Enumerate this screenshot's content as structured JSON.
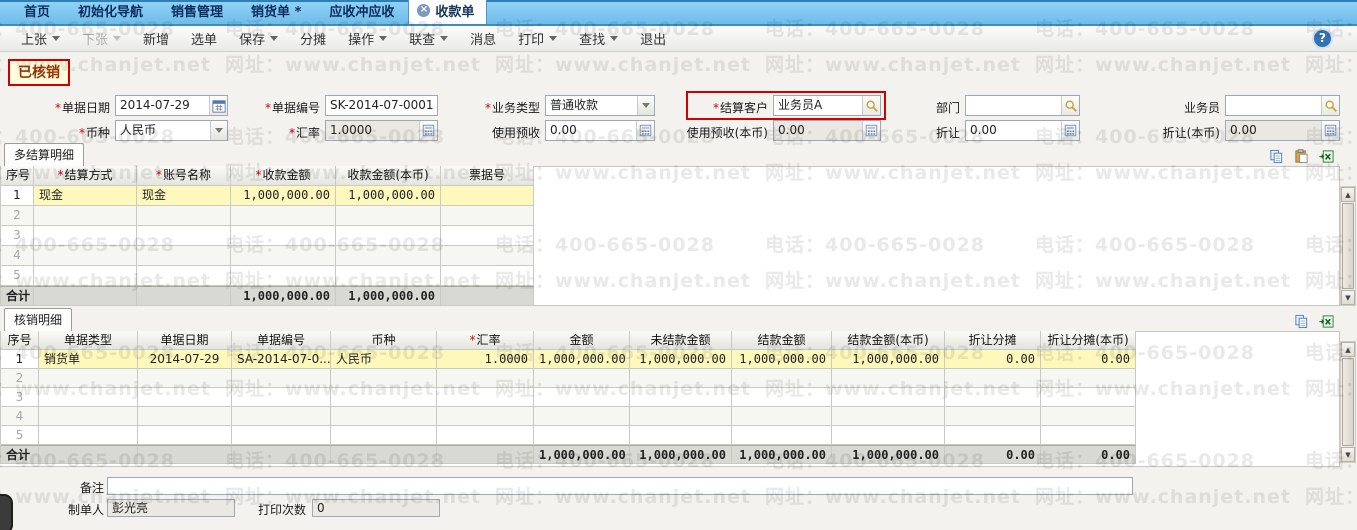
{
  "watermark": {
    "phone": "电话：400-665-0028",
    "url": "网址：www.chanjet.net"
  },
  "tabbar": {
    "tabs": [
      {
        "label": "首页"
      },
      {
        "label": "初始化导航"
      },
      {
        "label": "销售管理"
      },
      {
        "label": "销货单 *"
      },
      {
        "label": "应收冲应收"
      }
    ],
    "active_tab": {
      "label": "收款单"
    }
  },
  "toolbar": {
    "items": [
      {
        "label": "上张"
      },
      {
        "label": "下张"
      },
      {
        "label": "新增"
      },
      {
        "label": "选单"
      },
      {
        "label": "保存"
      },
      {
        "label": "分摊"
      },
      {
        "label": "操作"
      },
      {
        "label": "联查"
      },
      {
        "label": "消息"
      },
      {
        "label": "打印"
      },
      {
        "label": "查找"
      },
      {
        "label": "退出"
      }
    ],
    "help": "?"
  },
  "status_badge": "已核销",
  "form": {
    "bill_date": {
      "label": "单据日期",
      "value": "2014-07-29"
    },
    "bill_no": {
      "label": "单据编号",
      "value": "SK-2014-07-0001"
    },
    "biz_type": {
      "label": "业务类型",
      "value": "普通收款"
    },
    "customer": {
      "label": "结算客户",
      "value": "业务员A"
    },
    "dept": {
      "label": "部门",
      "value": ""
    },
    "salesman": {
      "label": "业务员",
      "value": ""
    },
    "currency": {
      "label": "币种",
      "value": "人民币"
    },
    "rate": {
      "label": "汇率",
      "value": "1.0000"
    },
    "advance": {
      "label": "使用预收",
      "value": "0.00"
    },
    "advance_local": {
      "label": "使用预收(本币)",
      "value": "0.00"
    },
    "discount": {
      "label": "折让",
      "value": "0.00"
    },
    "discount_local": {
      "label": "折让(本币)",
      "value": "0.00"
    }
  },
  "section1": {
    "tab_label": "多结算明细",
    "table": {
      "widths": [
        33,
        103,
        94,
        105,
        105,
        93
      ],
      "aligns": [
        "center",
        "left",
        "left",
        "right",
        "right",
        "left"
      ],
      "headers": [
        {
          "label": "序号"
        },
        {
          "label": "结算方式",
          "req": true
        },
        {
          "label": "账号名称",
          "req": true
        },
        {
          "label": "收款金额",
          "req": true
        },
        {
          "label": "收款金额(本币)"
        },
        {
          "label": "票据号"
        }
      ],
      "rows": [
        {
          "highlight": true,
          "cells": [
            "1",
            "现金",
            "现金",
            "1,000,000.00",
            "1,000,000.00",
            ""
          ]
        },
        {
          "cells": [
            "2",
            "",
            "",
            "",
            "",
            ""
          ]
        },
        {
          "cells": [
            "3",
            "",
            "",
            "",
            "",
            ""
          ]
        },
        {
          "cells": [
            "4",
            "",
            "",
            "",
            "",
            ""
          ]
        },
        {
          "cells": [
            "5",
            "",
            "",
            "",
            "",
            ""
          ]
        }
      ],
      "total": [
        "合计",
        "",
        "",
        "1,000,000.00",
        "1,000,000.00",
        ""
      ]
    }
  },
  "section2": {
    "tab_label": "核销明细",
    "table": {
      "widths": [
        38,
        99,
        94,
        99,
        106,
        97,
        96,
        102,
        100,
        113,
        96,
        95
      ],
      "aligns": [
        "center",
        "left",
        "center",
        "left",
        "left",
        "right",
        "right",
        "right",
        "right",
        "right",
        "right",
        "right"
      ],
      "headers": [
        {
          "label": "序号"
        },
        {
          "label": "单据类型"
        },
        {
          "label": "单据日期"
        },
        {
          "label": "单据编号"
        },
        {
          "label": "币种"
        },
        {
          "label": "汇率",
          "req": true
        },
        {
          "label": "金额"
        },
        {
          "label": "未结款金额"
        },
        {
          "label": "结款金额"
        },
        {
          "label": "结款金额(本币)"
        },
        {
          "label": "折让分摊"
        },
        {
          "label": "折让分摊(本币)"
        }
      ],
      "rows": [
        {
          "highlight": true,
          "cells": [
            "1",
            "销货单",
            "2014-07-29",
            "SA-2014-07-0...",
            "人民币",
            "1.0000",
            "1,000,000.00",
            "1,000,000.00",
            "1,000,000.00",
            "1,000,000.00",
            "0.00",
            "0.00"
          ]
        },
        {
          "cells": [
            "2",
            "",
            "",
            "",
            "",
            "",
            "",
            "",
            "",
            "",
            "",
            ""
          ]
        },
        {
          "cells": [
            "3",
            "",
            "",
            "",
            "",
            "",
            "",
            "",
            "",
            "",
            "",
            ""
          ]
        },
        {
          "cells": [
            "4",
            "",
            "",
            "",
            "",
            "",
            "",
            "",
            "",
            "",
            "",
            ""
          ]
        },
        {
          "cells": [
            "5",
            "",
            "",
            "",
            "",
            "",
            "",
            "",
            "",
            "",
            "",
            ""
          ]
        }
      ],
      "total": [
        "合计",
        "",
        "",
        "",
        "",
        "",
        "1,000,000.00",
        "1,000,000.00",
        "1,000,000.00",
        "1,000,000.00",
        "0.00",
        "0.00"
      ]
    }
  },
  "footer": {
    "remark": {
      "label": "备注",
      "value": ""
    },
    "creator": {
      "label": "制单人",
      "value": "彭光亮"
    },
    "print_count": {
      "label": "打印次数",
      "value": "0"
    }
  }
}
